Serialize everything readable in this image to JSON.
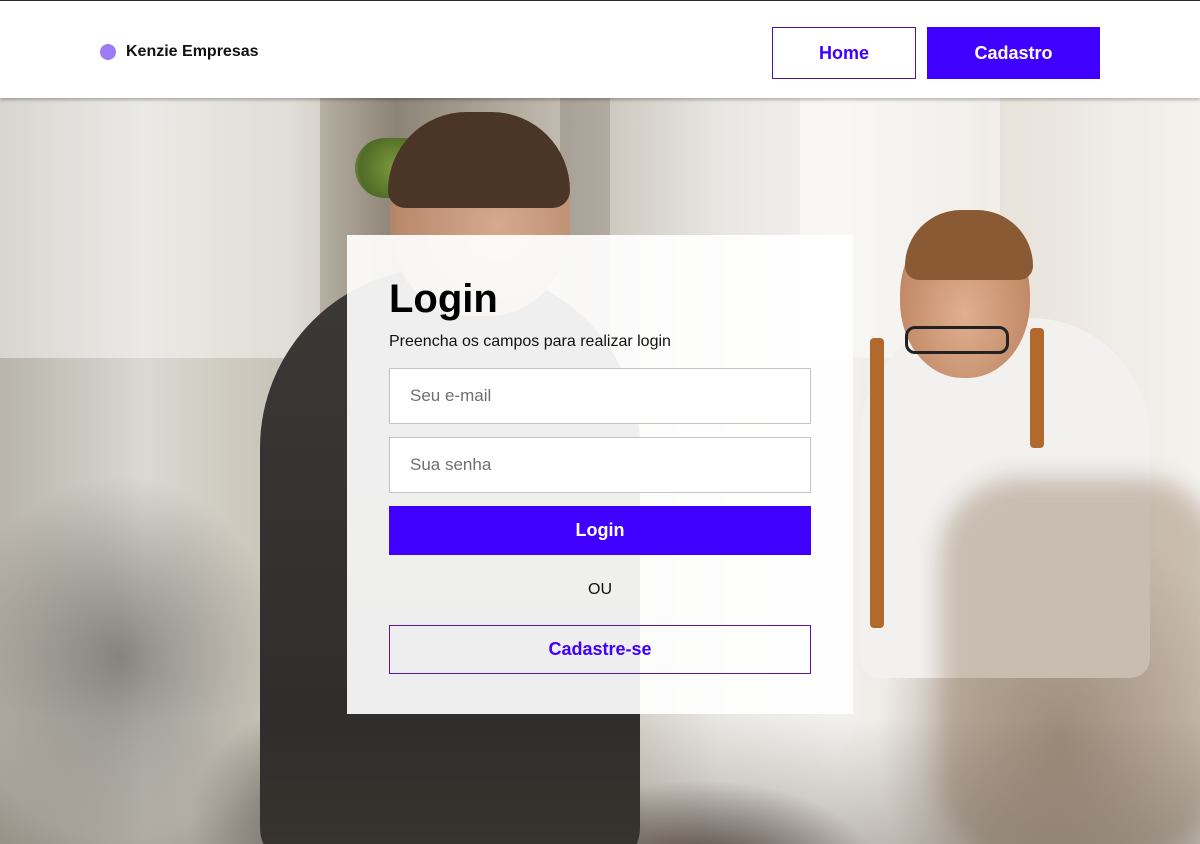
{
  "header": {
    "brand_name": "Kenzie Empresas",
    "nav": {
      "home_label": "Home",
      "cadastro_label": "Cadastro"
    }
  },
  "login_card": {
    "title": "Login",
    "subtitle": "Preencha os campos para realizar login",
    "email_placeholder": "Seu e-mail",
    "email_value": "",
    "password_placeholder": "Sua senha",
    "password_value": "",
    "login_button_label": "Login",
    "separator": "OU",
    "register_button_label": "Cadastre-se"
  },
  "colors": {
    "primary": "#4000ff",
    "brand_dot": "#9b7cf4",
    "outline": "#5a14b0"
  }
}
